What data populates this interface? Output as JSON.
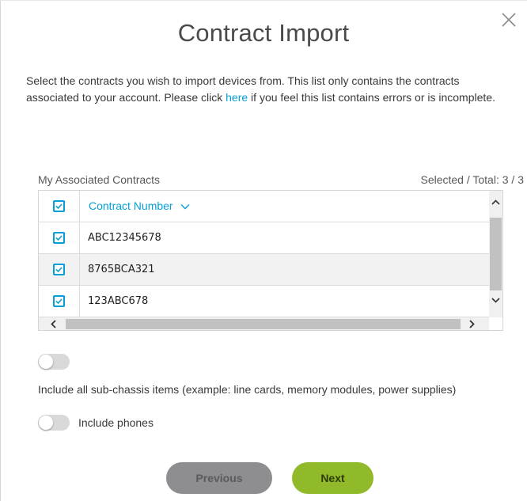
{
  "dialog": {
    "title": "Contract Import",
    "intro_before_link": "Select the contracts you wish to import devices from. This list only contains the contracts associated to your account. Please click ",
    "intro_link": "here",
    "intro_after_link": " if you feel this list contains errors or is incomplete."
  },
  "table": {
    "caption": "My Associated Contracts",
    "counter_label": "Selected / Total: ",
    "selected": "3",
    "separator": " / ",
    "total": "3",
    "column_header": "Contract Number",
    "rows": [
      {
        "contract_number": "ABC12345678",
        "checked": true
      },
      {
        "contract_number": "8765BCA321",
        "checked": true
      },
      {
        "contract_number": "123ABC678",
        "checked": true
      }
    ],
    "select_all_checked": true
  },
  "options": {
    "sub_chassis_label": "Include all sub-chassis items (example: line cards, memory modules, power supplies)",
    "sub_chassis_on": false,
    "phones_label": "Include phones",
    "phones_on": false
  },
  "buttons": {
    "previous": "Previous",
    "next": "Next"
  },
  "colors": {
    "accent": "#049fd9",
    "next_button": "#90ba2a",
    "previous_button": "#8e8e90"
  },
  "icons": {
    "close": "close-icon",
    "checkbox": "checkbox-checked-icon",
    "sort": "chevron-down-icon"
  }
}
